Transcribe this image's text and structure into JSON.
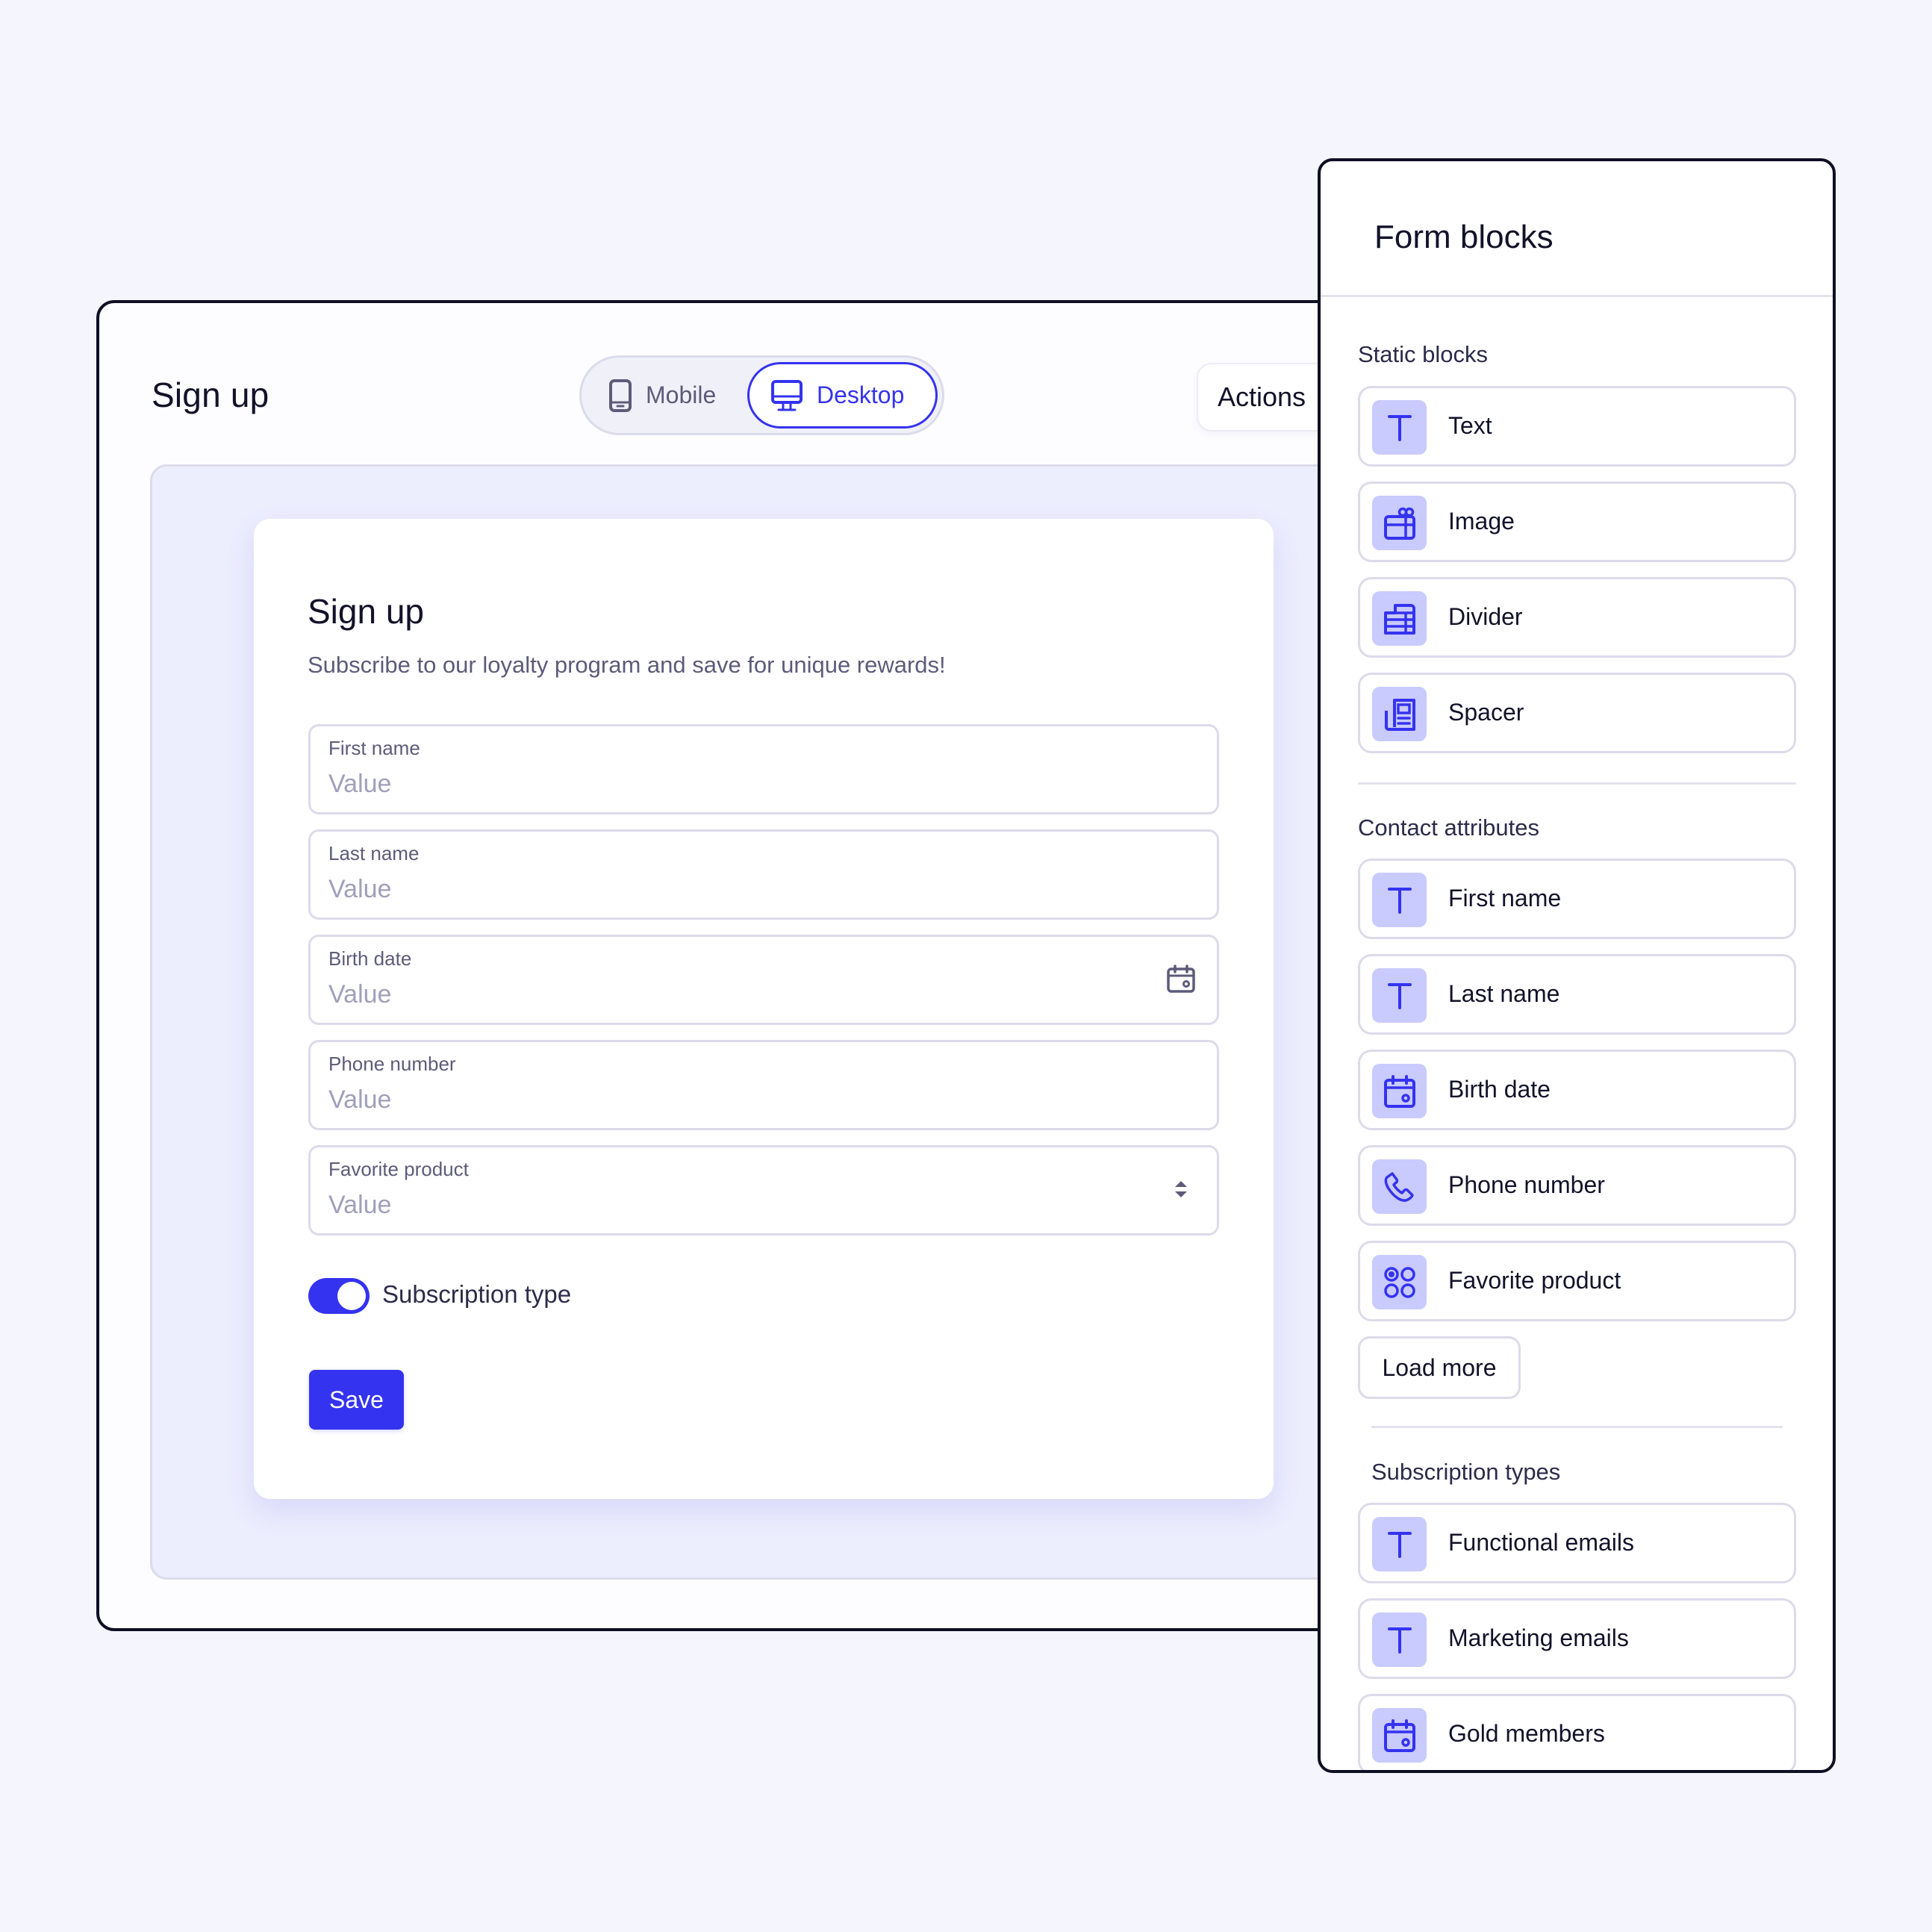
{
  "editor": {
    "title": "Sign up",
    "view_toggle": {
      "options": [
        {
          "label": "Mobile",
          "icon": "mobile-icon",
          "selected": false
        },
        {
          "label": "Desktop",
          "icon": "desktop-icon",
          "selected": true
        }
      ]
    },
    "actions_label": "Actions"
  },
  "form": {
    "title": "Sign up",
    "subtitle": "Subscribe to our loyalty program and save for unique rewards!",
    "fields": [
      {
        "label": "First name",
        "placeholder": "Value",
        "icon": null
      },
      {
        "label": "Last name",
        "placeholder": "Value",
        "icon": null
      },
      {
        "label": "Birth date",
        "placeholder": "Value",
        "icon": "calendar-icon"
      },
      {
        "label": "Phone number",
        "placeholder": "Value",
        "icon": null
      },
      {
        "label": "Favorite product",
        "placeholder": "Value",
        "icon": "select-arrows-icon"
      }
    ],
    "toggle": {
      "label": "Subscription type",
      "on": true
    },
    "save_label": "Save"
  },
  "panel": {
    "title": "Form blocks",
    "sections": [
      {
        "label": "Static blocks",
        "items": [
          {
            "label": "Text",
            "icon": "text-icon"
          },
          {
            "label": "Image",
            "icon": "gift-icon"
          },
          {
            "label": "Divider",
            "icon": "table-icon"
          },
          {
            "label": "Spacer",
            "icon": "newspaper-icon"
          }
        ]
      },
      {
        "label": "Contact attributes",
        "items": [
          {
            "label": "First name",
            "icon": "text-icon"
          },
          {
            "label": "Last name",
            "icon": "text-icon"
          },
          {
            "label": "Birth date",
            "icon": "calendar-icon"
          },
          {
            "label": "Phone number",
            "icon": "phone-icon"
          },
          {
            "label": "Favorite product",
            "icon": "radio-grid-icon"
          }
        ],
        "load_more_label": "Load more"
      },
      {
        "label": "Subscription types",
        "items": [
          {
            "label": "Functional emails",
            "icon": "text-icon"
          },
          {
            "label": "Marketing emails",
            "icon": "text-icon"
          },
          {
            "label": "Gold members",
            "icon": "calendar-icon"
          }
        ]
      }
    ]
  },
  "colors": {
    "accent": "#3433f0",
    "icon_tile": "#c9cafd",
    "canvas": "#ecedfd",
    "border": "#dcdbea",
    "frame": "#0f0f24"
  }
}
